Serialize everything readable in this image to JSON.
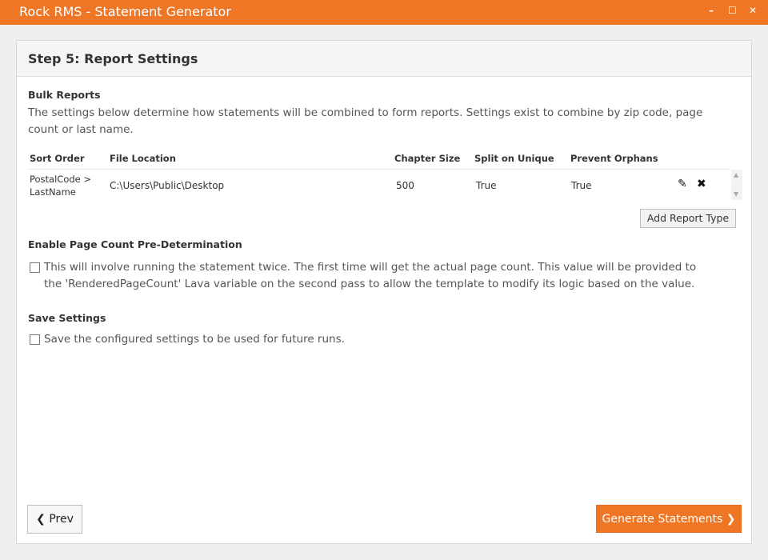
{
  "window": {
    "title": "Rock RMS - Statement Generator",
    "controls": {
      "minimize": "–",
      "maximize": "☐",
      "close": "✕"
    }
  },
  "step": {
    "title": "Step 5: Report Settings"
  },
  "bulk_reports": {
    "heading": "Bulk Reports",
    "description": "The settings below determine how statements will be combined to form reports. Settings exist to combine by zip code, page count or last name.",
    "table": {
      "headers": [
        "Sort Order",
        "File Location",
        "Chapter Size",
        "Split on Unique",
        "Prevent Orphans"
      ],
      "rows": [
        {
          "sort_order_line1": "PostalCode >",
          "sort_order_line2": "LastName",
          "file_location": "C:\\Users\\Public\\Desktop",
          "chapter_size": "500",
          "split_on_unique": "True",
          "prevent_orphans": "True"
        }
      ]
    },
    "add_button": "Add Report Type",
    "icons": {
      "edit": "pencil-icon",
      "delete": "close-icon"
    }
  },
  "page_count": {
    "heading": "Enable Page Count Pre-Determination",
    "checkbox_label": "This will involve running the statement twice. The first time will get the actual page count. This value will be provided to the 'RenderedPageCount' Lava variable on the second pass to allow the template to modify its logic based on the value.",
    "checked": false
  },
  "save_settings": {
    "heading": "Save Settings",
    "checkbox_label": "Save the configured settings to be used for future runs.",
    "checked": false
  },
  "footer": {
    "prev_label": "Prev",
    "generate_label": "Generate Statements"
  },
  "colors": {
    "accent": "#ee7625"
  }
}
